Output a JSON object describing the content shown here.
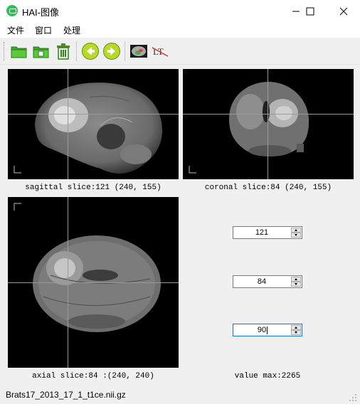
{
  "window": {
    "title": "HAI-图像"
  },
  "menu": {
    "items": [
      "文件",
      "窗口",
      "处理"
    ]
  },
  "toolbar": {
    "buttons": [
      "open-folder-icon",
      "save-icon",
      "trash-icon",
      "back-arrow-icon",
      "forward-arrow-icon",
      "brain-view-icon",
      "erase-label-icon"
    ],
    "erase_label_glyph": "LT"
  },
  "views": {
    "sagittal": {
      "caption": "sagittal slice:121 (240, 155)"
    },
    "coronal": {
      "caption": "coronal slice:84 (240, 155)"
    },
    "axial": {
      "caption": "axial slice:84 :(240, 240)"
    }
  },
  "controls": {
    "sagittal_value": "121",
    "coronal_value": "84",
    "axial_value": "90",
    "value_max": "value max:2265"
  },
  "status": {
    "filename": "Brats17_2013_17_1_t1ce.nii.gz"
  },
  "colors": {
    "accent": "#0078d7",
    "app_icon": "#2fbf5a",
    "toolbar_arrow": "#6aa61a"
  }
}
